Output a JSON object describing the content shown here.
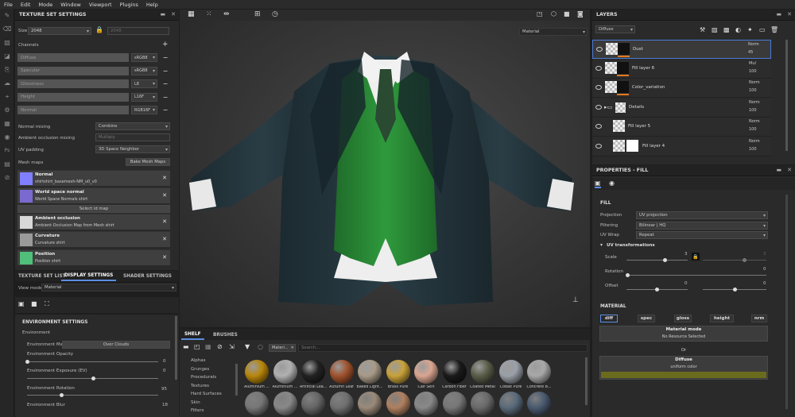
{
  "menu": [
    "File",
    "Edit",
    "Mode",
    "Window",
    "Viewport",
    "Plugins",
    "Help"
  ],
  "texture_set_settings": {
    "title": "TEXTURE SET SETTINGS",
    "size_label": "Size",
    "size_value": "2048",
    "size_linked": "2048",
    "channels_label": "Channels",
    "channels": [
      {
        "name": "Diffuse",
        "format": "sRGB8"
      },
      {
        "name": "Specular",
        "format": "sRGB8"
      },
      {
        "name": "Glossiness",
        "format": "L8"
      },
      {
        "name": "Height",
        "format": "L16F"
      },
      {
        "name": "Normal",
        "format": "RGB16F"
      }
    ],
    "normal_mixing_label": "Normal mixing",
    "normal_mixing_value": "Combine",
    "ao_mixing_label": "Ambient occlusion mixing",
    "ao_mixing_value": "Multiply",
    "uv_padding_label": "UV padding",
    "uv_padding_value": "3D Space Neighbor",
    "mesh_maps_label": "Mesh maps",
    "bake_button": "Bake Mesh Maps",
    "mesh_maps": [
      {
        "title": "Normal",
        "sub": "shirtshirt_basemesh-NM_u0_v0",
        "color": "#8080ff"
      },
      {
        "title": "World space normal",
        "sub": "World Space Normals shirt",
        "color": "#7a6ad0"
      },
      {
        "title": "Ambient occlusion",
        "sub": "Ambient Occlusion Map from Mesh shirt",
        "color": "#d8d8d8"
      },
      {
        "title": "Curvature",
        "sub": "Curvature shirt",
        "color": "#9a9a9a"
      },
      {
        "title": "Position",
        "sub": "Position shirt",
        "color": "#4fbf7a"
      }
    ],
    "select_id_map": "Select id map"
  },
  "bottom_tabs": [
    "TEXTURE SET LIST",
    "DISPLAY SETTINGS",
    "SHADER SETTINGS"
  ],
  "display_settings": {
    "view_mode_label": "View mode",
    "view_mode_value": "Material",
    "env_header": "ENVIRONMENT SETTINGS",
    "env_label": "Environment",
    "env_map_label": "Environment Map",
    "env_map_value": "Over Clouds",
    "env_opacity_label": "Environment Opacity",
    "env_opacity_value": "0",
    "env_opacity_level": 0,
    "env_exposure_label": "Environment Exposure (EV)",
    "env_exposure_value": "0",
    "env_exposure_level": 0.5,
    "env_rotation_label": "Environment Rotation",
    "env_rotation_value": "95",
    "env_rotation_level": 0.26,
    "env_blur_label": "Environment Blur",
    "env_blur_value": "18"
  },
  "viewport": {
    "mode_select": "Material"
  },
  "layers": {
    "title": "LAYERS",
    "channel_select": "Diffuse",
    "items": [
      {
        "name": "Dust",
        "blend": "Norm",
        "opacity": "45",
        "selected": true
      },
      {
        "name": "Fill layer 6",
        "blend": "Mul",
        "opacity": "100"
      },
      {
        "name": "Color_variation",
        "blend": "Norm",
        "opacity": "100"
      },
      {
        "name": "Details",
        "blend": "Norm",
        "opacity": "100"
      },
      {
        "name": "Fill layer 5",
        "blend": "Norm",
        "opacity": "100"
      },
      {
        "name": "Fill layer 4",
        "blend": "Norm",
        "opacity": "100"
      }
    ]
  },
  "properties": {
    "title": "PROPERTIES - FILL",
    "fill_label": "FILL",
    "projection_label": "Projection",
    "projection_value": "UV projection",
    "filtering_label": "Filtering",
    "filtering_value": "Bilinear | HQ",
    "uvwrap_label": "UV Wrap",
    "uvwrap_value": "Repeat",
    "uvt_label": "UV transformations",
    "scale_label": "Scale",
    "scale_value": "3",
    "scale_value2": "3",
    "rotation_label": "Rotation",
    "rotation_value": "0",
    "offset_label": "Offset",
    "offset_value": "0",
    "offset_value2": "0",
    "material_label": "MATERIAL",
    "channels": [
      "diff",
      "spec",
      "gloss",
      "height",
      "nrm"
    ],
    "material_mode_title": "Material mode",
    "material_mode_sub": "No Resource Selected",
    "or": "Or",
    "diffuse_title": "Diffuse",
    "diffuse_sub": "uniform color",
    "diffuse_color": "#6b6b1e"
  },
  "shelf": {
    "tabs": [
      "SHELF",
      "BRUSHES"
    ],
    "filter_tag": "Materi...",
    "search_placeholder": "Search...",
    "categories": [
      "Alphas",
      "Grunges",
      "Procedurals",
      "Textures",
      "Hard Surfaces",
      "Skin",
      "Filters"
    ],
    "materials": [
      {
        "name": "Aluminium ...",
        "color": "#b8860b"
      },
      {
        "name": "Aluminium ...",
        "color": "#b0b0b0"
      },
      {
        "name": "Artificial Lea...",
        "color": "#222222"
      },
      {
        "name": "Autumn Leaf",
        "color": "#a0522d"
      },
      {
        "name": "Baked Light...",
        "color": "#a89a88"
      },
      {
        "name": "Brass Pure",
        "color": "#c9a13a"
      },
      {
        "name": "Calf Skin",
        "color": "#d9a590"
      },
      {
        "name": "Carbon Fiber",
        "color": "#1a1a1a"
      },
      {
        "name": "Coated Metal",
        "color": "#5a5d48"
      },
      {
        "name": "Cobalt Pure",
        "color": "#9aa0a8"
      },
      {
        "name": "Concrete B...",
        "color": "#a8a8a8"
      }
    ],
    "row2_colors": [
      "#777777",
      "#888888",
      "#666666",
      "#707070",
      "#9a8a7a",
      "#b08060",
      "#888888",
      "#777777",
      "#6a6a6a",
      "#5a6a7a",
      "#4a5a70"
    ]
  }
}
